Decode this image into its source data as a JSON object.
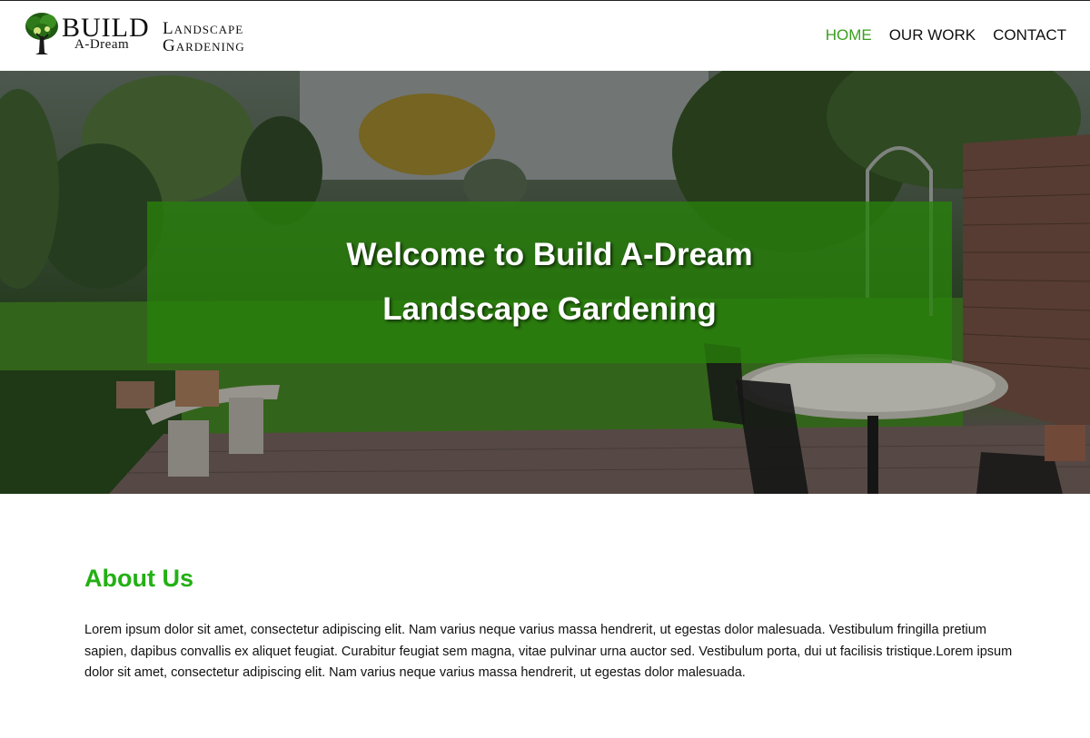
{
  "logo": {
    "brand_top": "Build",
    "brand_bottom": "A-Dream",
    "tagline_line1": "Landscape",
    "tagline_line2": "Gardening",
    "icon": "tree-icon"
  },
  "nav": {
    "items": [
      {
        "label": "HOME",
        "active": true
      },
      {
        "label": "OUR WORK",
        "active": false
      },
      {
        "label": "CONTACT",
        "active": false
      }
    ],
    "active_color": "#3a9e1e"
  },
  "hero": {
    "line1": "Welcome to Build A-Dream",
    "line2": "Landscape Gardening",
    "box_color": "#28820a"
  },
  "about": {
    "heading": "About Us",
    "heading_color": "#22b014",
    "body": "Lorem ipsum dolor sit amet, consectetur adipiscing elit. Nam varius neque varius massa hendrerit, ut egestas dolor malesuada. Vestibulum fringilla pretium sapien, dapibus convallis ex aliquet feugiat. Curabitur feugiat sem magna, vitae pulvinar urna auctor sed. Vestibulum porta, dui ut facilisis tristique.Lorem ipsum dolor sit amet, consectetur adipiscing elit. Nam varius neque varius massa hendrerit, ut egestas dolor malesuada."
  }
}
